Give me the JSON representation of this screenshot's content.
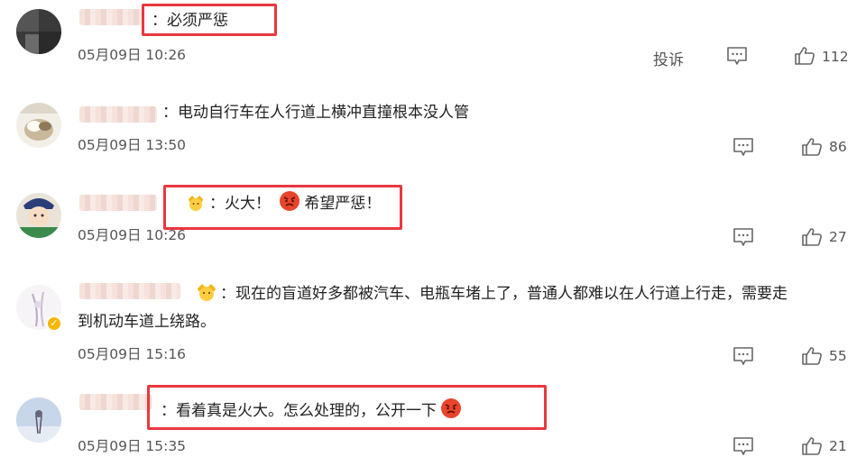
{
  "comments": [
    {
      "text": "：必须严惩",
      "timestamp": "05月09日 10:26",
      "report_label": "投诉",
      "like_count": "112"
    },
    {
      "text": "：电动自行车在人行道上横冲直撞根本没人管",
      "timestamp": "05月09日 13:50",
      "like_count": "86"
    },
    {
      "text_part1": "：火大！",
      "text_part2": "希望严惩！",
      "timestamp": "05月09日 10:26",
      "like_count": "27"
    },
    {
      "text_line1": "：现在的盲道好多都被汽车、电瓶车堵上了，普通人都难以在人行道上行走，需要走",
      "text_line2": "到机动车道上绕路。",
      "timestamp": "05月09日 15:16",
      "like_count": "55"
    },
    {
      "text": "：看着真是火大。怎么处理的，公开一下",
      "timestamp": "05月09日 15:35",
      "like_count": "21"
    }
  ],
  "colors": {
    "highlight": "#e8383f",
    "text": "#222222",
    "meta": "#555555"
  },
  "icons": {
    "reply": "comment-bubble-icon",
    "like": "thumbs-up-icon",
    "emoji_angry": "angry-face-emoji",
    "emoji_crown": "crown-face-emoji"
  }
}
